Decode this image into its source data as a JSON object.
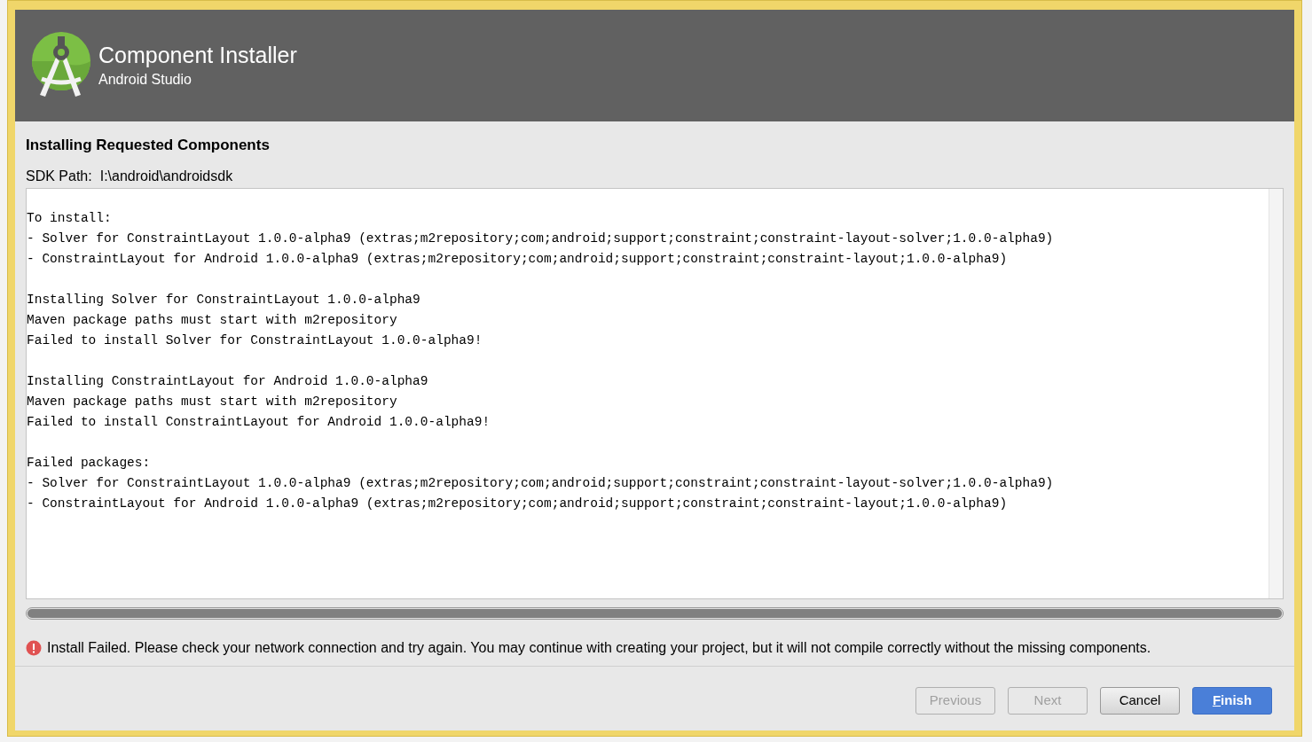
{
  "window": {
    "title": "Component Installer",
    "subtitle": "Android Studio"
  },
  "section_title": "Installing Requested Components",
  "sdk_path": {
    "label": "SDK Path:",
    "value": "I:\\android\\androidsdk"
  },
  "log": [
    {
      "lines": [
        "To install:",
        "- Solver for ConstraintLayout 1.0.0-alpha9 (extras;m2repository;com;android;support;constraint;constraint-layout-solver;1.0.0-alpha9)",
        "- ConstraintLayout for Android 1.0.0-alpha9 (extras;m2repository;com;android;support;constraint;constraint-layout;1.0.0-alpha9)"
      ]
    },
    {
      "lines": [
        "Installing Solver for ConstraintLayout 1.0.0-alpha9",
        "Maven package paths must start with m2repository",
        "Failed to install Solver for ConstraintLayout 1.0.0-alpha9!"
      ]
    },
    {
      "lines": [
        "Installing ConstraintLayout for Android 1.0.0-alpha9",
        "Maven package paths must start with m2repository",
        "Failed to install ConstraintLayout for Android 1.0.0-alpha9!"
      ]
    },
    {
      "lines": [
        "Failed packages:",
        "- Solver for ConstraintLayout 1.0.0-alpha9 (extras;m2repository;com;android;support;constraint;constraint-layout-solver;1.0.0-alpha9)",
        "- ConstraintLayout for Android 1.0.0-alpha9 (extras;m2repository;com;android;support;constraint;constraint-layout;1.0.0-alpha9)"
      ]
    }
  ],
  "progress": {
    "level": 1
  },
  "error_message": "Install Failed. Please check your network connection and try again. You may continue with creating your project, but it will not compile correctly without the missing components.",
  "buttons": [
    {
      "label": "Previous",
      "disabled": true,
      "default": false,
      "mnemonic": false
    },
    {
      "label": "Next",
      "disabled": true,
      "default": false,
      "mnemonic": false
    },
    {
      "label": "Cancel",
      "disabled": false,
      "default": false,
      "mnemonic": false
    },
    {
      "label": "Finish",
      "disabled": false,
      "default": true,
      "mnemonic": true
    }
  ]
}
